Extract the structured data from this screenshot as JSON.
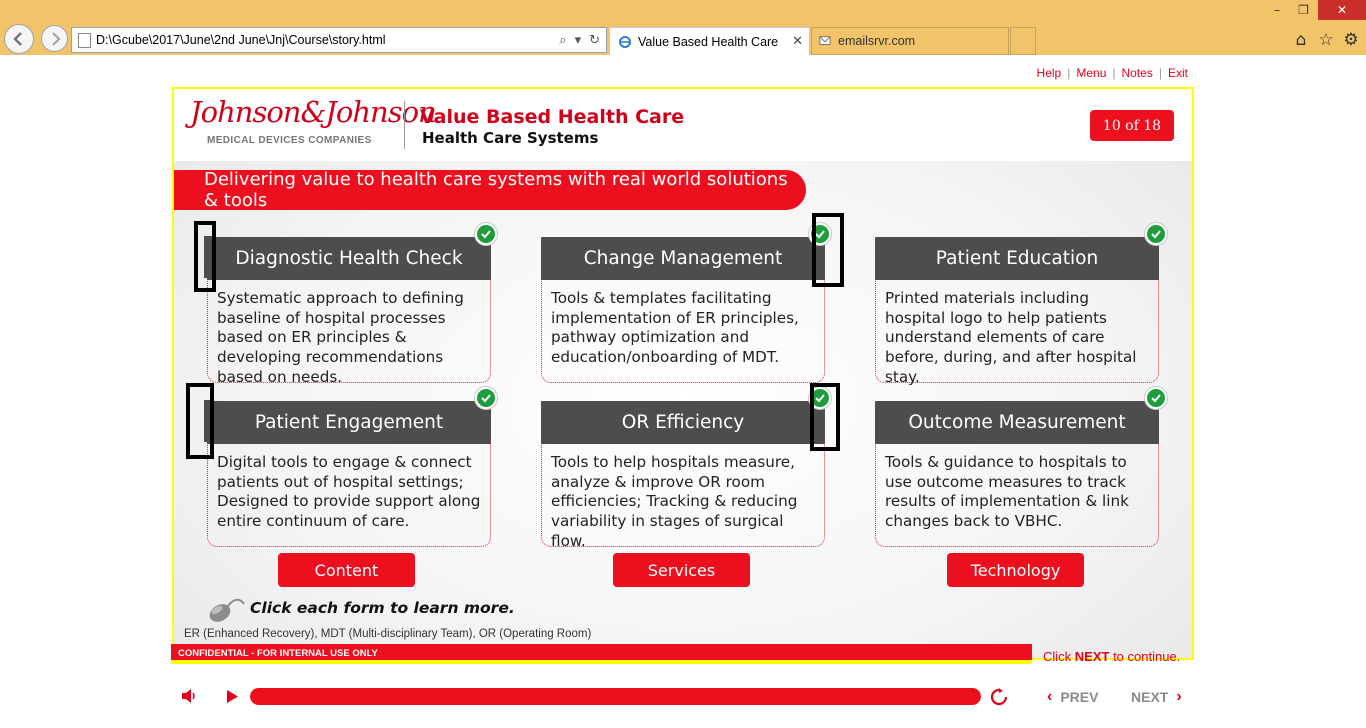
{
  "browser": {
    "address": "D:\\Gcube\\2017\\June\\2nd June\\Jnj\\Course\\story.html",
    "tabs": [
      {
        "label": "Value Based Health Care",
        "active": true
      },
      {
        "label": "emailsrvr.com",
        "active": false
      }
    ],
    "icons": [
      "back-icon",
      "forward-icon",
      "search-icon",
      "refresh-icon",
      "home-icon",
      "favorites-icon",
      "settings-icon"
    ]
  },
  "top_links": {
    "help": "Help",
    "sep": "|",
    "menu": "Menu",
    "notes": "Notes",
    "exit": "Exit"
  },
  "header": {
    "logo_script": "Johnson&Johnson",
    "logo_sub": "MEDICAL DEVICES COMPANIES",
    "title": "Value Based Health Care",
    "subtitle": "Health Care Systems",
    "page_indicator": "10 of 18"
  },
  "banner": "Delivering value to health care systems with real world solutions & tools",
  "cards": [
    {
      "title": "Diagnostic Health Check",
      "body": "Systematic approach to defining baseline of hospital processes based on ER principles & developing recommendations based on needs.",
      "completed": true
    },
    {
      "title": "Change Management",
      "body": "Tools & templates facilitating implementation of ER principles, pathway optimization and education/onboarding of MDT.",
      "completed": true
    },
    {
      "title": "Patient Education",
      "body": "Printed materials including hospital logo to help patients understand elements of care before, during, and after hospital stay.",
      "completed": true
    },
    {
      "title": "Patient Engagement",
      "body": "Digital tools to engage & connect patients out of hospital settings; Designed to provide support along entire continuum of care.",
      "completed": true
    },
    {
      "title": "OR Efficiency",
      "body": "Tools to help hospitals measure, analyze & improve OR room efficiencies; Tracking & reducing variability in stages of surgical flow.",
      "completed": true
    },
    {
      "title": "Outcome Measurement",
      "body": "Tools & guidance to hospitals to use outcome measures to track results of implementation & link changes back to VBHC.",
      "completed": true
    }
  ],
  "categories": {
    "content": "Content",
    "services": "Services",
    "technology": "Technology"
  },
  "instruction": "Click each form to learn more.",
  "footnote": "ER (Enhanced Recovery), MDT (Multi-disciplinary Team), OR (Operating Room)",
  "confidential": "CONFIDENTIAL - FOR INTERNAL USE ONLY",
  "click_next": {
    "pre": "Click ",
    "next": "NEXT",
    "post": " to continue."
  },
  "player": {
    "progress": 1.0,
    "prev": "PREV",
    "next": "NEXT"
  },
  "colors": {
    "brand_red": "#ec0f1e",
    "card_header": "#4d4d4d",
    "check_green": "#1f9c3b",
    "frame_yellow": "#ffff00"
  }
}
